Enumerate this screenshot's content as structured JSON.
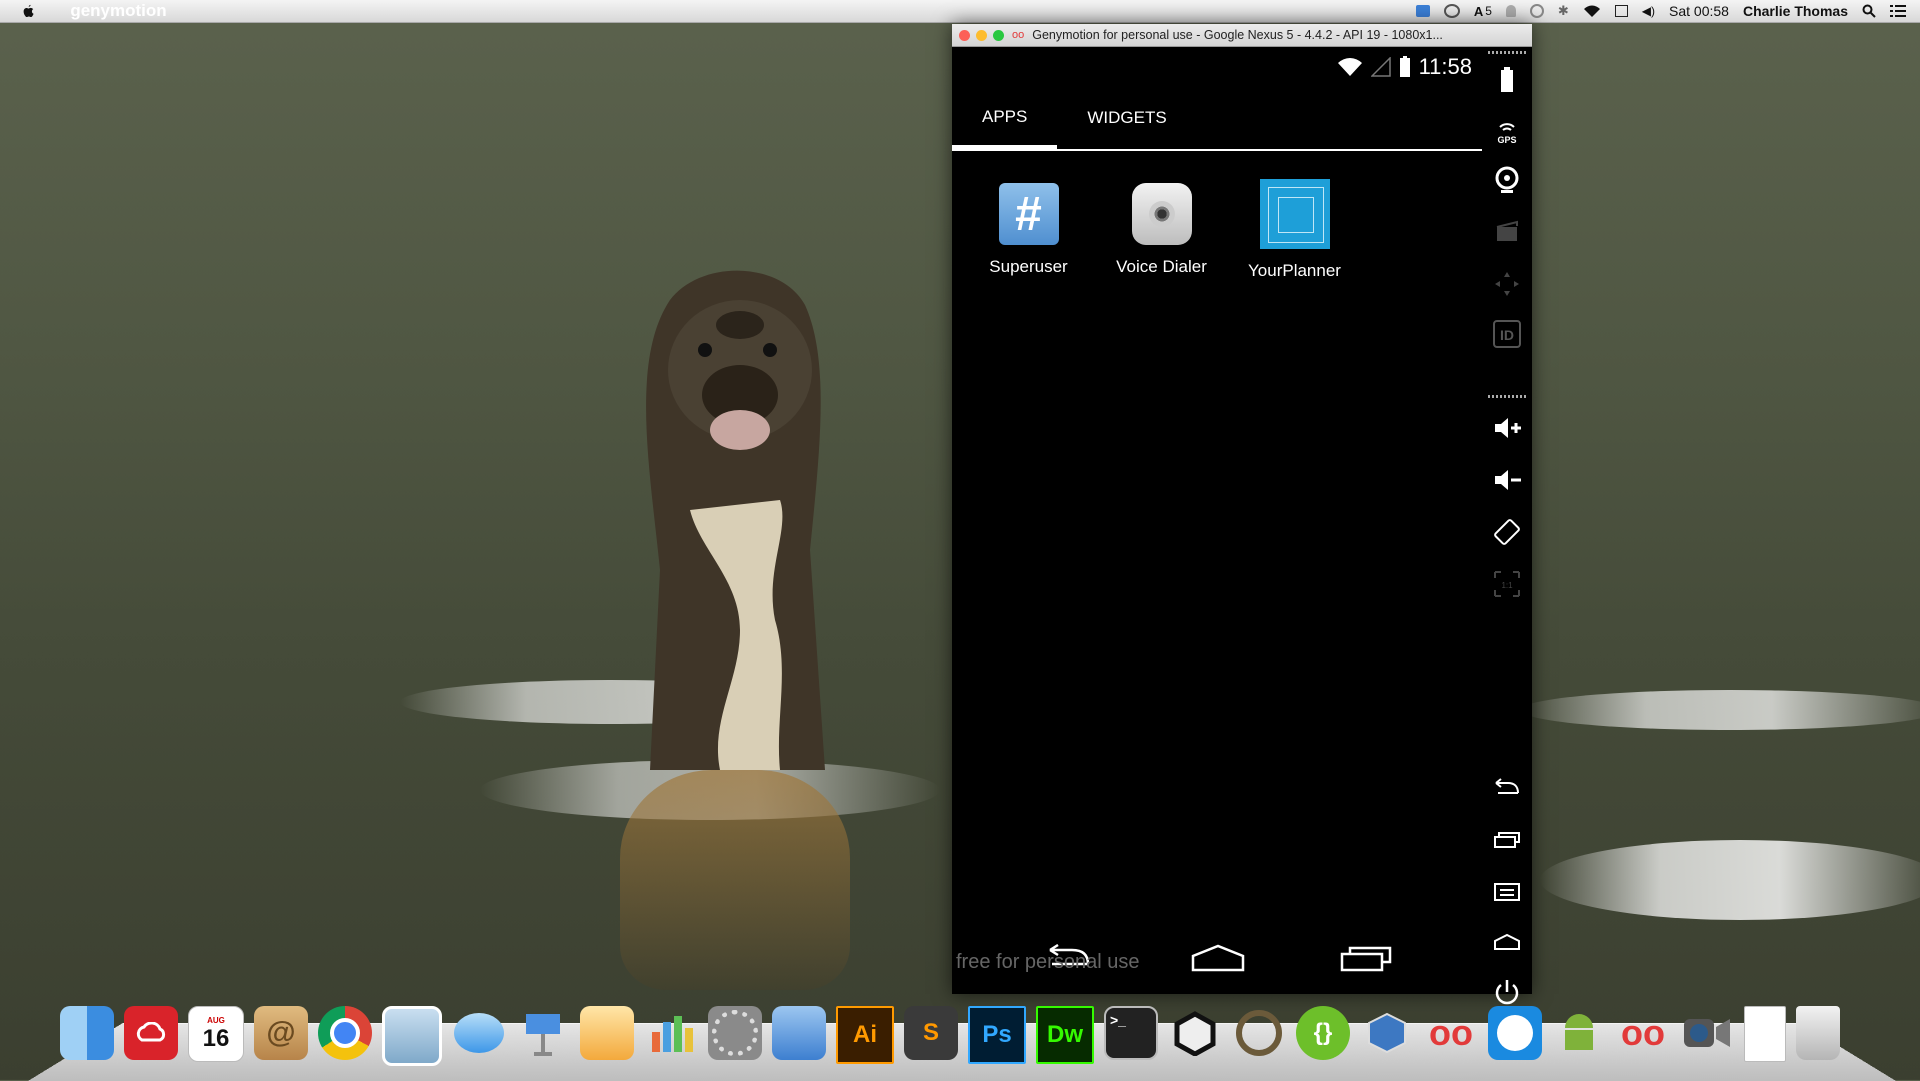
{
  "menubar": {
    "app_name": "genymotion",
    "clock": "Sat 00:58",
    "user": "Charlie Thomas",
    "status_number": "5"
  },
  "window": {
    "title": "Genymotion for personal use - Google Nexus 5 - 4.4.2 - API 19 - 1080x1..."
  },
  "android": {
    "time": "11:58",
    "tabs": [
      "APPS",
      "WIDGETS"
    ],
    "apps": [
      {
        "label": "Superuser",
        "color": "#5b9ad6"
      },
      {
        "label": "Voice Dialer",
        "color": "#d6d6d6"
      },
      {
        "label": "YourPlanner",
        "color": "#1e9fd8"
      }
    ],
    "watermark": "free for personal use"
  },
  "sidebar_icons": [
    "battery-icon",
    "gps-icon",
    "webcam-icon",
    "camera-icon",
    "dpad-icon",
    "id-icon",
    "volume-up-icon",
    "volume-down-icon",
    "rotate-icon",
    "scale-icon",
    "back-icon",
    "recent-apps-icon",
    "menu-icon",
    "home-icon",
    "power-icon"
  ],
  "dock": {
    "calendar_day": "16",
    "calendar_month": "AUG",
    "items": [
      {
        "name": "finder",
        "label": "",
        "color": "#5aa4e6"
      },
      {
        "name": "creative-cloud",
        "label": "",
        "color": "#d9232a"
      },
      {
        "name": "calendar",
        "label": "16",
        "color": "#ffffff"
      },
      {
        "name": "contacts",
        "label": "@",
        "color": "#c99a5b"
      },
      {
        "name": "chrome",
        "label": "",
        "color": "#ffffff"
      },
      {
        "name": "preview",
        "label": "",
        "color": "#7fa9c9"
      },
      {
        "name": "messages",
        "label": "",
        "color": "#69b3f0"
      },
      {
        "name": "keynote",
        "label": "",
        "color": "#4a8fe0"
      },
      {
        "name": "pages",
        "label": "",
        "color": "#f3a93c"
      },
      {
        "name": "numbers",
        "label": "",
        "color": "#5cbf55"
      },
      {
        "name": "system-preferences",
        "label": "",
        "color": "#8a8a8a"
      },
      {
        "name": "xcode",
        "label": "",
        "color": "#5b9ae0"
      },
      {
        "name": "illustrator",
        "label": "Ai",
        "color": "#3a1e00"
      },
      {
        "name": "sublime",
        "label": "S",
        "color": "#3a3a3a"
      },
      {
        "name": "photoshop",
        "label": "Ps",
        "color": "#001d33"
      },
      {
        "name": "dreamweaver",
        "label": "Dw",
        "color": "#062b00"
      },
      {
        "name": "terminal",
        "label": ">_",
        "color": "#222222"
      },
      {
        "name": "unity",
        "label": "",
        "color": "#e8e8e8"
      },
      {
        "name": "eso",
        "label": "",
        "color": "#6b5a3a"
      },
      {
        "name": "brackets",
        "label": "{}",
        "color": "#6dbf2a"
      },
      {
        "name": "virtualbox",
        "label": "",
        "color": "#3d78c2"
      },
      {
        "name": "genymotion",
        "label": "",
        "color": "#e23a3a"
      },
      {
        "name": "teamviewer",
        "label": "",
        "color": "#1a8ae0"
      },
      {
        "name": "android-sdk",
        "label": "",
        "color": "#7fb23a"
      },
      {
        "name": "genymotion-2",
        "label": "",
        "color": "#e23a3a"
      },
      {
        "name": "facetime",
        "label": "",
        "color": "#555555"
      },
      {
        "name": "document",
        "label": "",
        "color": "#ffffff"
      },
      {
        "name": "trash",
        "label": "",
        "color": "#cfcfcf"
      }
    ]
  }
}
